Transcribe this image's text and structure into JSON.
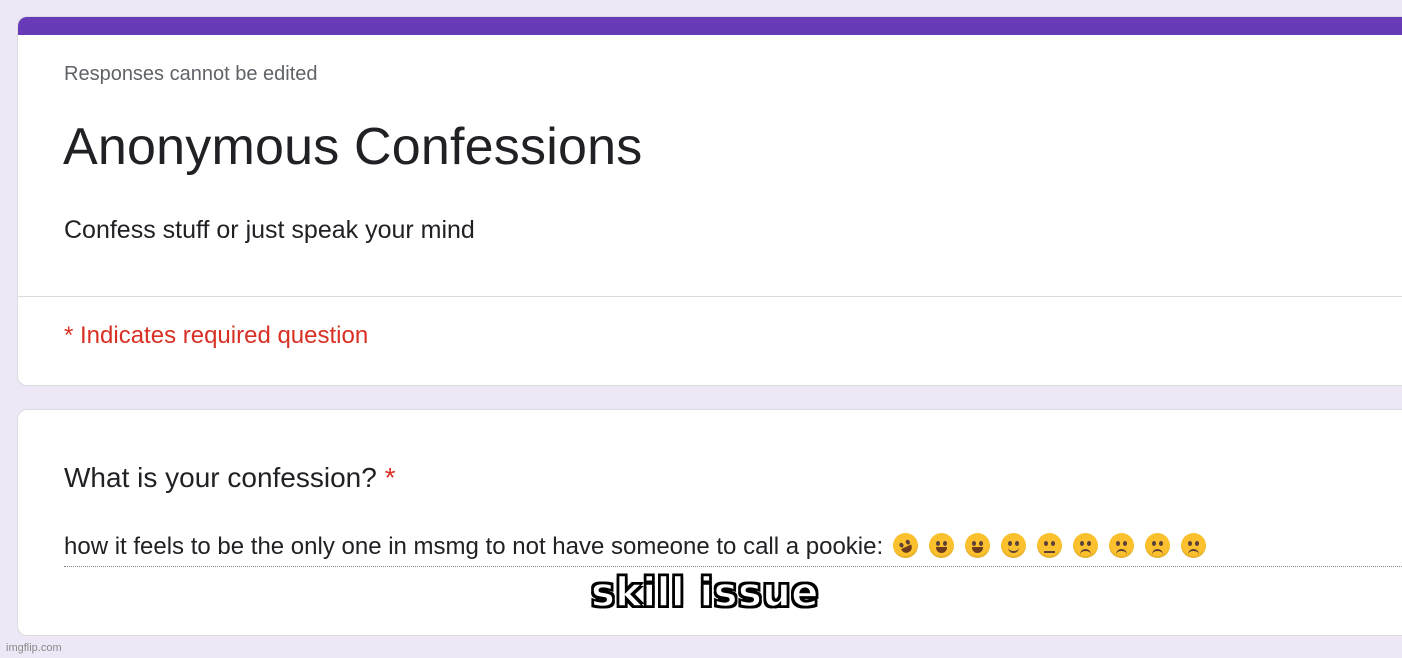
{
  "form": {
    "accent_color": "#673ab7",
    "note": "Responses cannot be edited",
    "title": "Anonymous Confessions",
    "description": "Confess stuff or just speak your mind",
    "required_note": "* Indicates required question"
  },
  "question": {
    "label": "What is your confession?",
    "required_marker": "*",
    "answer_text": "how it feels to be the only one in msmg to not have someone to call a pookie:",
    "emojis": [
      "rolling-on-floor-laughing",
      "face-with-tears-of-joy",
      "zany-face",
      "slightly-smiling-face",
      "neutral-face",
      "frowning-face",
      "downcast-face-with-sweat",
      "pensive-face",
      "confused-face"
    ]
  },
  "overlay": {
    "caption": "skill issue",
    "watermark": "imgflip.com"
  }
}
